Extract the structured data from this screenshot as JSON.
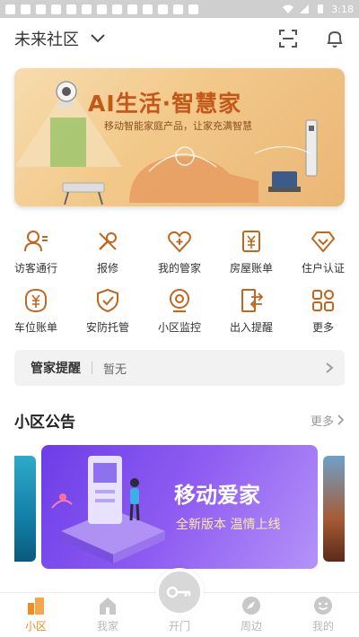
{
  "status_bar": {
    "time": "3:18"
  },
  "header": {
    "community_name": "未来社区"
  },
  "banner": {
    "title": "AI生活·智慧家",
    "subtitle": "移动智能家庭产品，让家充满智慧"
  },
  "services": [
    {
      "label": "访客通行",
      "icon": "visitor-icon"
    },
    {
      "label": "报修",
      "icon": "repair-icon"
    },
    {
      "label": "我的管家",
      "icon": "butler-icon"
    },
    {
      "label": "房屋账单",
      "icon": "house-bill-icon"
    },
    {
      "label": "住户认证",
      "icon": "resident-cert-icon"
    },
    {
      "label": "车位账单",
      "icon": "parking-bill-icon"
    },
    {
      "label": "安防托管",
      "icon": "security-icon"
    },
    {
      "label": "小区监控",
      "icon": "camera-icon"
    },
    {
      "label": "出入提醒",
      "icon": "access-alert-icon"
    },
    {
      "label": "更多",
      "icon": "more-grid-icon"
    }
  ],
  "reminder": {
    "title": "管家提醒",
    "value": "暂无"
  },
  "announcements": {
    "title": "小区公告",
    "more": "更多",
    "card": {
      "title": "移动爱家",
      "subtitle": "全新版本 温情上线"
    }
  },
  "bottom_nav": [
    {
      "label": "小区",
      "active": true
    },
    {
      "label": "我家",
      "active": false
    },
    {
      "label": "开门",
      "active": false
    },
    {
      "label": "周边",
      "active": false
    },
    {
      "label": "我的",
      "active": false
    }
  ],
  "colors": {
    "accent": "#f08c1e",
    "inactive": "#b8b8b8",
    "icon": "#c0661d"
  }
}
